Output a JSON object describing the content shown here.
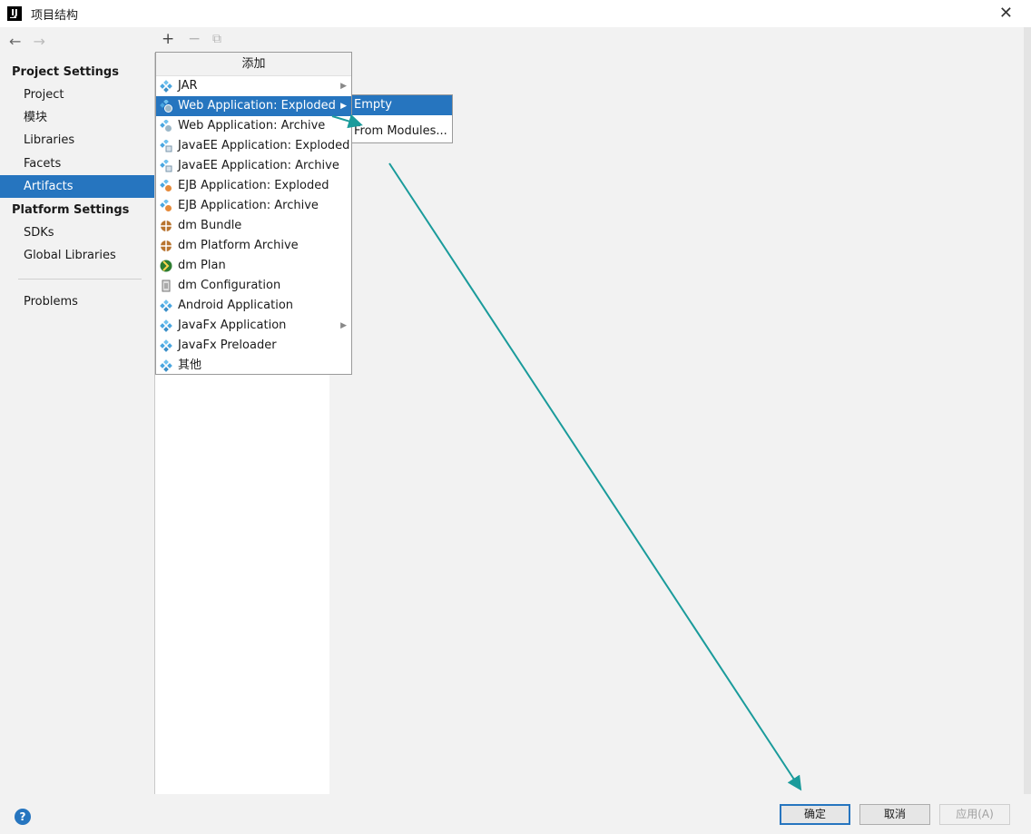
{
  "window": {
    "title": "项目结构"
  },
  "nav": {
    "project_settings_heading": "Project Settings",
    "project_items": [
      {
        "label": "Project",
        "selected": false
      },
      {
        "label": "模块",
        "selected": false
      },
      {
        "label": "Libraries",
        "selected": false
      },
      {
        "label": "Facets",
        "selected": false
      },
      {
        "label": "Artifacts",
        "selected": true
      }
    ],
    "platform_settings_heading": "Platform Settings",
    "platform_items": [
      {
        "label": "SDKs"
      },
      {
        "label": "Global Libraries"
      }
    ],
    "problems_label": "Problems"
  },
  "popup": {
    "header": "添加",
    "items": [
      {
        "label": "JAR",
        "icon": "diamond-icon",
        "submenu": true,
        "highlighted": false
      },
      {
        "label": "Web Application: Exploded",
        "icon": "web-app-icon",
        "submenu": true,
        "highlighted": true
      },
      {
        "label": "Web Application: Archive",
        "icon": "web-app-icon",
        "submenu": false,
        "highlighted": false
      },
      {
        "label": "JavaEE Application: Exploded",
        "icon": "javaee-app-icon",
        "submenu": false,
        "highlighted": false
      },
      {
        "label": "JavaEE Application: Archive",
        "icon": "javaee-app-icon",
        "submenu": false,
        "highlighted": false
      },
      {
        "label": "EJB Application: Exploded",
        "icon": "ejb-app-icon",
        "submenu": false,
        "highlighted": false
      },
      {
        "label": "EJB Application: Archive",
        "icon": "ejb-app-icon",
        "submenu": false,
        "highlighted": false
      },
      {
        "label": "dm Bundle",
        "icon": "bundle-icon",
        "submenu": false,
        "highlighted": false
      },
      {
        "label": "dm Platform Archive",
        "icon": "bundle-icon",
        "submenu": false,
        "highlighted": false
      },
      {
        "label": "dm Plan",
        "icon": "plan-icon",
        "submenu": false,
        "highlighted": false
      },
      {
        "label": "dm Configuration",
        "icon": "config-file-icon",
        "submenu": false,
        "highlighted": false
      },
      {
        "label": "Android Application",
        "icon": "diamond-icon",
        "submenu": false,
        "highlighted": false
      },
      {
        "label": "JavaFx Application",
        "icon": "diamond-icon",
        "submenu": true,
        "highlighted": false
      },
      {
        "label": "JavaFx Preloader",
        "icon": "diamond-icon",
        "submenu": false,
        "highlighted": false
      },
      {
        "label": "其他",
        "icon": "diamond-icon",
        "submenu": false,
        "highlighted": false
      }
    ]
  },
  "submenu": {
    "items": [
      {
        "label": "Empty",
        "highlighted": true
      },
      {
        "label": "From Modules...",
        "highlighted": false
      }
    ]
  },
  "buttons": {
    "ok": "确定",
    "cancel": "取消",
    "apply": "应用(A)"
  },
  "colors": {
    "selection": "#2675bf",
    "annotation_arrow": "#1a9b9b"
  }
}
